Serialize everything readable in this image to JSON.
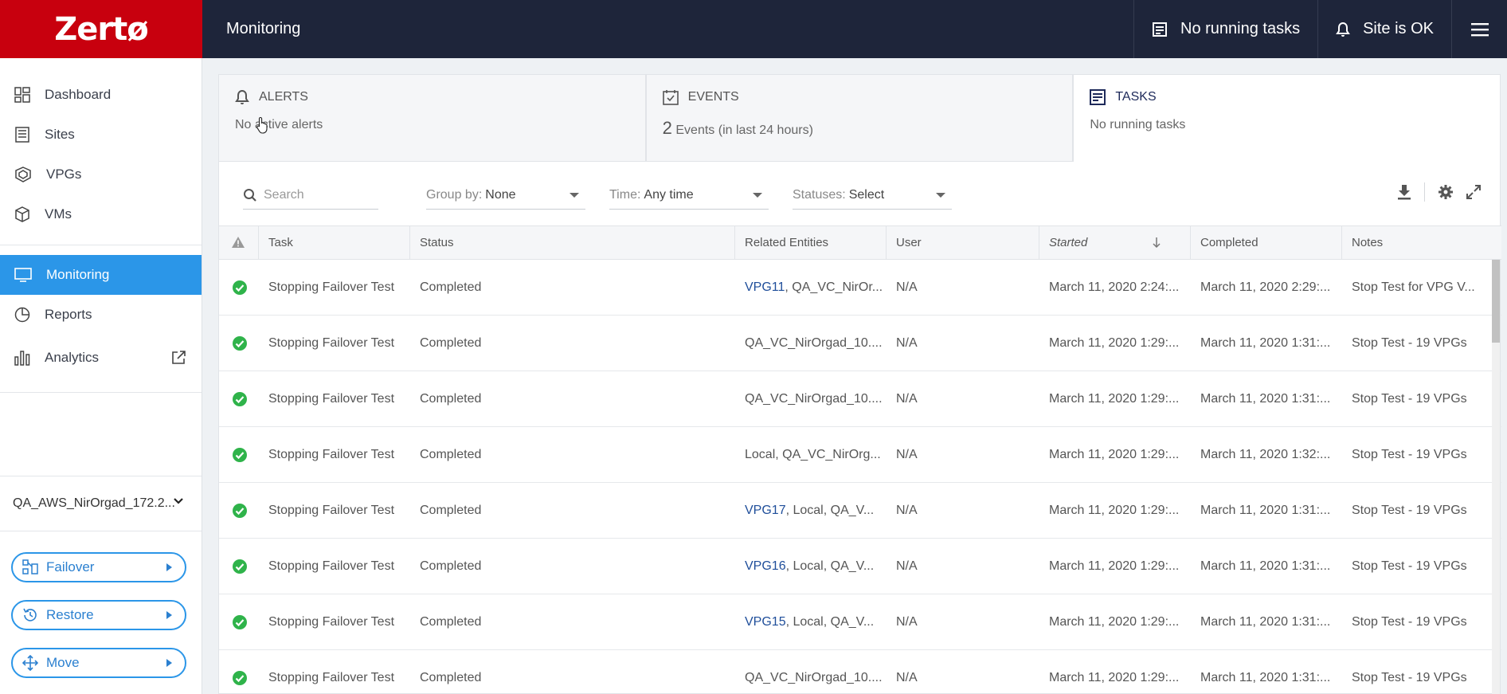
{
  "header": {
    "logo": "Zertø",
    "title": "Monitoring",
    "tasks_status": "No running tasks",
    "site_status": "Site is OK"
  },
  "sidebar": {
    "items": [
      {
        "label": "Dashboard",
        "icon": "dashboard-icon"
      },
      {
        "label": "Sites",
        "icon": "sites-icon"
      },
      {
        "label": "VPGs",
        "icon": "vpgs-icon"
      },
      {
        "label": "VMs",
        "icon": "vms-icon"
      },
      {
        "label": "Monitoring",
        "icon": "monitoring-icon",
        "active": true
      },
      {
        "label": "Reports",
        "icon": "reports-icon"
      },
      {
        "label": "Analytics",
        "icon": "analytics-icon"
      }
    ],
    "site": "QA_AWS_NirOrgad_172.2...",
    "actions": [
      {
        "label": "Failover",
        "icon": "failover-icon"
      },
      {
        "label": "Restore",
        "icon": "restore-icon"
      },
      {
        "label": "Move",
        "icon": "move-icon"
      }
    ]
  },
  "cards": {
    "alerts": {
      "title": "ALERTS",
      "text": "No active alerts"
    },
    "events": {
      "title": "EVENTS",
      "count": "2",
      "text": "Events (in last 24 hours)"
    },
    "tasks": {
      "title": "TASKS",
      "text": "No running tasks"
    }
  },
  "toolbar": {
    "search_placeholder": "Search",
    "group_by": {
      "label": "Group by:",
      "value": "None"
    },
    "time": {
      "label": "Time:",
      "value": "Any time"
    },
    "statuses": {
      "label": "Statuses:",
      "value": "Select"
    }
  },
  "table": {
    "columns": [
      "Task",
      "Status",
      "Related Entities",
      "User",
      "Started",
      "Completed",
      "Notes"
    ],
    "rows": [
      {
        "task": "Stopping Failover Test",
        "status": "Completed",
        "entity_link": "VPG11",
        "entity_rest": ", QA_VC_NirOr...",
        "user": "N/A",
        "started": "March 11, 2020 2:24:...",
        "completed": "March 11, 2020 2:29:...",
        "notes": "Stop Test for VPG V..."
      },
      {
        "task": "Stopping Failover Test",
        "status": "Completed",
        "entity_link": "",
        "entity_rest": "QA_VC_NirOrgad_10....",
        "user": "N/A",
        "started": "March 11, 2020 1:29:...",
        "completed": "March 11, 2020 1:31:...",
        "notes": "Stop Test - 19 VPGs"
      },
      {
        "task": "Stopping Failover Test",
        "status": "Completed",
        "entity_link": "",
        "entity_rest": "QA_VC_NirOrgad_10....",
        "user": "N/A",
        "started": "March 11, 2020 1:29:...",
        "completed": "March 11, 2020 1:31:...",
        "notes": "Stop Test - 19 VPGs"
      },
      {
        "task": "Stopping Failover Test",
        "status": "Completed",
        "entity_link": "",
        "entity_rest": "Local, QA_VC_NirOrg...",
        "user": "N/A",
        "started": "March 11, 2020 1:29:...",
        "completed": "March 11, 2020 1:32:...",
        "notes": "Stop Test - 19 VPGs"
      },
      {
        "task": "Stopping Failover Test",
        "status": "Completed",
        "entity_link": "VPG17",
        "entity_rest": ", Local, QA_V...",
        "user": "N/A",
        "started": "March 11, 2020 1:29:...",
        "completed": "March 11, 2020 1:31:...",
        "notes": "Stop Test - 19 VPGs"
      },
      {
        "task": "Stopping Failover Test",
        "status": "Completed",
        "entity_link": "VPG16",
        "entity_rest": ", Local, QA_V...",
        "user": "N/A",
        "started": "March 11, 2020 1:29:...",
        "completed": "March 11, 2020 1:31:...",
        "notes": "Stop Test - 19 VPGs"
      },
      {
        "task": "Stopping Failover Test",
        "status": "Completed",
        "entity_link": "VPG15",
        "entity_rest": ", Local, QA_V...",
        "user": "N/A",
        "started": "March 11, 2020 1:29:...",
        "completed": "March 11, 2020 1:31:...",
        "notes": "Stop Test - 19 VPGs"
      },
      {
        "task": "Stopping Failover Test",
        "status": "Completed",
        "entity_link": "",
        "entity_rest": "QA_VC_NirOrgad_10....",
        "user": "N/A",
        "started": "March 11, 2020 1:29:...",
        "completed": "March 11, 2020 1:31:...",
        "notes": "Stop Test - 19 VPGs"
      }
    ]
  },
  "colors": {
    "header_bg": "#1e253a",
    "logo_bg": "#c8000e",
    "accent": "#2b96e8",
    "success": "#2fb34a",
    "link": "#1f4e9a"
  }
}
